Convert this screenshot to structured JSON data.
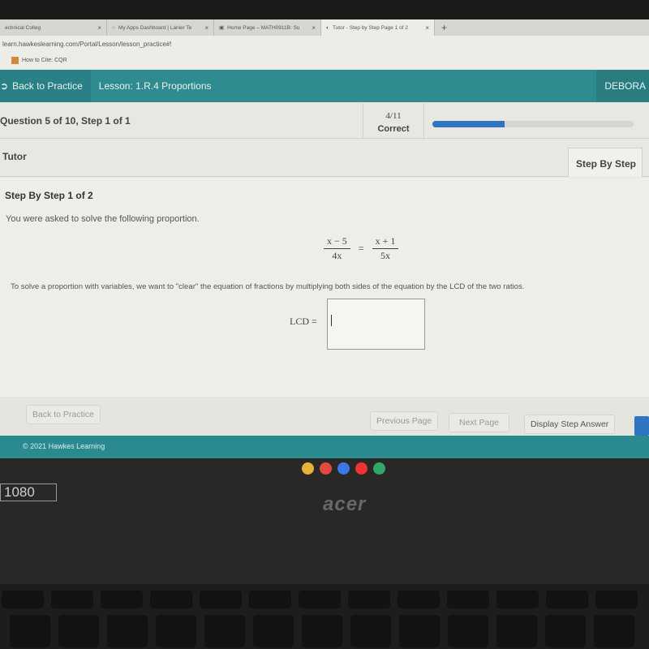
{
  "browser": {
    "tabs": [
      {
        "label": "echnical Colleg",
        "icon": "page-icon"
      },
      {
        "label": "My Apps Dashboard | Lanier Te",
        "icon": "circle-icon"
      },
      {
        "label": "Home Page – MATH0911B: Su",
        "icon": "course-icon"
      },
      {
        "label": "Tutor - Step by Step Page 1 of 2",
        "icon": "globe-icon",
        "active": true
      }
    ],
    "new_tab": "+",
    "close": "×",
    "url": "learn.hawkeslearning.com/Portal/Lesson/lesson_practice#!",
    "bookmark": "How to Cite: CQR"
  },
  "nav": {
    "back": "Back to Practice",
    "lesson": "Lesson: 1.R.4 Proportions",
    "user": "DEBORA"
  },
  "question": {
    "label": "Question 5 of 10,  Step 1 of 1",
    "score": "4/11",
    "score_label": "Correct",
    "progress_percent": 36,
    "progress_color": "#2f74c0"
  },
  "tutor": {
    "label": "Tutor",
    "tab": "Step By Step"
  },
  "content": {
    "heading": "Step By Step 1 of 2",
    "intro": "You were asked to solve the following proportion.",
    "equation": {
      "left_num": "x − 5",
      "left_den": "4x",
      "equals": "=",
      "right_num": "x + 1",
      "right_den": "5x"
    },
    "instruction": "To solve a proportion with variables, we want to \"clear\" the equation of fractions by multiplying both sides of the equation by the LCD of the two ratios.",
    "lcd_label": "LCD =",
    "lcd_value": ""
  },
  "buttons": {
    "back": "Back to Practice",
    "previous": "Previous Page",
    "next": "Next Page",
    "display": "Display Step Answer"
  },
  "footer": "© 2021 Hawkes Learning",
  "device": {
    "sticker": "1080",
    "brand": "acer"
  },
  "colors": {
    "teal": "#2f8b8f",
    "blue": "#2f74c0"
  }
}
